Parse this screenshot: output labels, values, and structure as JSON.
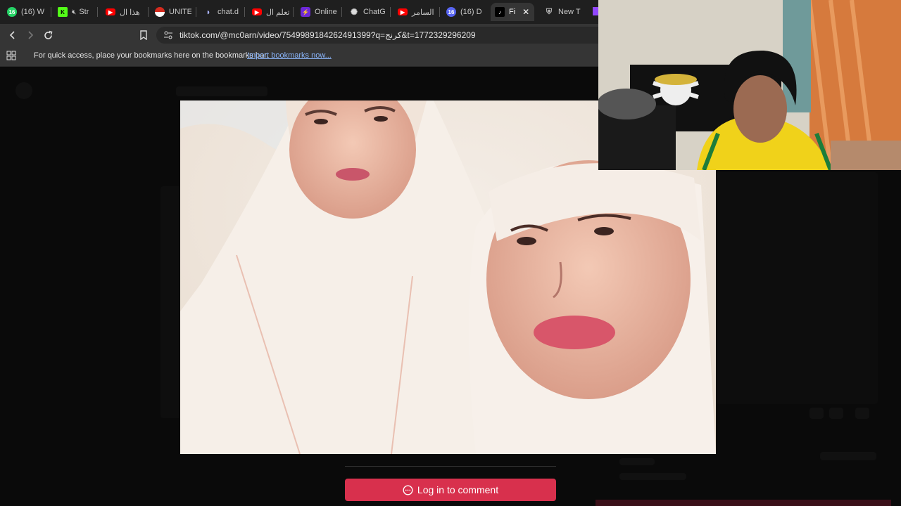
{
  "browser": {
    "tabs": [
      {
        "label": "(16) W",
        "icon": "whatsapp-badge-icon",
        "color": "#25d366",
        "badge": "16"
      },
      {
        "label": "Str",
        "icon": "kick-muted-icon",
        "color": "#53fc18",
        "badge": "K"
      },
      {
        "label": "هذا ال",
        "icon": "youtube-icon",
        "color": "#ff0000",
        "badge": "▶"
      },
      {
        "label": "UNITE",
        "icon": "flag-icon",
        "color": "#d52b1e",
        "badge": ""
      },
      {
        "label": "chat.d",
        "icon": "deepseek-icon",
        "color": "#4d6bfe",
        "badge": ""
      },
      {
        "label": "تعلم ال",
        "icon": "youtube-icon",
        "color": "#ff0000",
        "badge": "▶"
      },
      {
        "label": "Online",
        "icon": "bolt-icon",
        "color": "#6d28d9",
        "badge": "⚡"
      },
      {
        "label": "ChatG",
        "icon": "openai-icon",
        "color": "#888888",
        "badge": "✺"
      },
      {
        "label": "السامر",
        "icon": "youtube-icon",
        "color": "#ff0000",
        "badge": "▶"
      },
      {
        "label": "(16) D",
        "icon": "discord-badge-icon",
        "color": "#5865f2",
        "badge": "16"
      },
      {
        "label": "Fi",
        "icon": "tiktok-icon",
        "color": "#000000",
        "badge": "♪",
        "active": true
      },
      {
        "label": "New T",
        "icon": "shield-icon",
        "color": "#aaaaaa",
        "badge": ""
      }
    ],
    "close_glyph": "✕",
    "url": "tiktok.com/@mc0arn/video/7549989184262491399?q=كرنج&t=1772329296209",
    "bookmarks_message": "For quick access, place your bookmarks here on the bookmarks bar.",
    "import_link": "Import bookmarks now..."
  },
  "page": {
    "login_button": "Log in to comment",
    "accent": "#d8304d"
  }
}
